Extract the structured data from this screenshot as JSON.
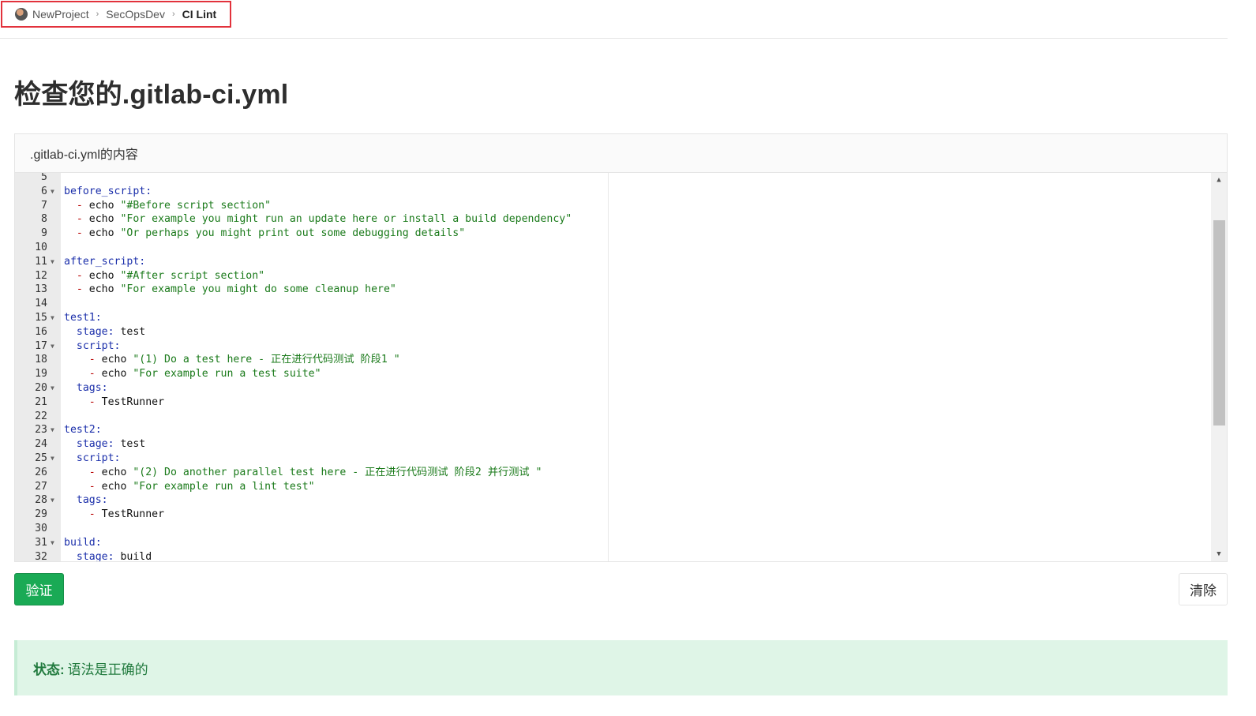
{
  "breadcrumb": {
    "items": [
      {
        "label": "NewProject"
      },
      {
        "label": "SecOpsDev"
      },
      {
        "label": "CI Lint"
      }
    ],
    "separator": "›"
  },
  "page": {
    "title": "检查您的.gitlab-ci.yml"
  },
  "panel": {
    "header": ".gitlab-ci.yml的内容"
  },
  "editor": {
    "lines": [
      {
        "n": "5",
        "fold": false,
        "tokens": []
      },
      {
        "n": "6",
        "fold": true,
        "tokens": [
          {
            "t": "key",
            "v": "before_script:"
          }
        ]
      },
      {
        "n": "7",
        "fold": false,
        "tokens": [
          {
            "t": "plain",
            "v": "  "
          },
          {
            "t": "dash",
            "v": "- "
          },
          {
            "t": "plain",
            "v": "echo "
          },
          {
            "t": "str",
            "v": "\"#Before script section\""
          }
        ]
      },
      {
        "n": "8",
        "fold": false,
        "tokens": [
          {
            "t": "plain",
            "v": "  "
          },
          {
            "t": "dash",
            "v": "- "
          },
          {
            "t": "plain",
            "v": "echo "
          },
          {
            "t": "str",
            "v": "\"For example you might run an update here or install a build dependency\""
          }
        ]
      },
      {
        "n": "9",
        "fold": false,
        "tokens": [
          {
            "t": "plain",
            "v": "  "
          },
          {
            "t": "dash",
            "v": "- "
          },
          {
            "t": "plain",
            "v": "echo "
          },
          {
            "t": "str",
            "v": "\"Or perhaps you might print out some debugging details\""
          }
        ]
      },
      {
        "n": "10",
        "fold": false,
        "tokens": []
      },
      {
        "n": "11",
        "fold": true,
        "tokens": [
          {
            "t": "key",
            "v": "after_script:"
          }
        ]
      },
      {
        "n": "12",
        "fold": false,
        "tokens": [
          {
            "t": "plain",
            "v": "  "
          },
          {
            "t": "dash",
            "v": "- "
          },
          {
            "t": "plain",
            "v": "echo "
          },
          {
            "t": "str",
            "v": "\"#After script section\""
          }
        ]
      },
      {
        "n": "13",
        "fold": false,
        "tokens": [
          {
            "t": "plain",
            "v": "  "
          },
          {
            "t": "dash",
            "v": "- "
          },
          {
            "t": "plain",
            "v": "echo "
          },
          {
            "t": "str",
            "v": "\"For example you might do some cleanup here\""
          }
        ]
      },
      {
        "n": "14",
        "fold": false,
        "tokens": []
      },
      {
        "n": "15",
        "fold": true,
        "tokens": [
          {
            "t": "key",
            "v": "test1:"
          }
        ]
      },
      {
        "n": "16",
        "fold": false,
        "tokens": [
          {
            "t": "plain",
            "v": "  "
          },
          {
            "t": "key",
            "v": "stage:"
          },
          {
            "t": "plain",
            "v": " test"
          }
        ]
      },
      {
        "n": "17",
        "fold": true,
        "tokens": [
          {
            "t": "plain",
            "v": "  "
          },
          {
            "t": "key",
            "v": "script:"
          }
        ]
      },
      {
        "n": "18",
        "fold": false,
        "tokens": [
          {
            "t": "plain",
            "v": "    "
          },
          {
            "t": "dash",
            "v": "- "
          },
          {
            "t": "plain",
            "v": "echo "
          },
          {
            "t": "str",
            "v": "\"(1) Do a test here - 正在进行代码测试 阶段1 \""
          }
        ]
      },
      {
        "n": "19",
        "fold": false,
        "tokens": [
          {
            "t": "plain",
            "v": "    "
          },
          {
            "t": "dash",
            "v": "- "
          },
          {
            "t": "plain",
            "v": "echo "
          },
          {
            "t": "str",
            "v": "\"For example run a test suite\""
          }
        ]
      },
      {
        "n": "20",
        "fold": true,
        "tokens": [
          {
            "t": "plain",
            "v": "  "
          },
          {
            "t": "key",
            "v": "tags:"
          }
        ]
      },
      {
        "n": "21",
        "fold": false,
        "tokens": [
          {
            "t": "plain",
            "v": "    "
          },
          {
            "t": "dash",
            "v": "- "
          },
          {
            "t": "plain",
            "v": "TestRunner"
          }
        ]
      },
      {
        "n": "22",
        "fold": false,
        "tokens": []
      },
      {
        "n": "23",
        "fold": true,
        "tokens": [
          {
            "t": "key",
            "v": "test2:"
          }
        ]
      },
      {
        "n": "24",
        "fold": false,
        "tokens": [
          {
            "t": "plain",
            "v": "  "
          },
          {
            "t": "key",
            "v": "stage:"
          },
          {
            "t": "plain",
            "v": " test"
          }
        ]
      },
      {
        "n": "25",
        "fold": true,
        "tokens": [
          {
            "t": "plain",
            "v": "  "
          },
          {
            "t": "key",
            "v": "script:"
          }
        ]
      },
      {
        "n": "26",
        "fold": false,
        "tokens": [
          {
            "t": "plain",
            "v": "    "
          },
          {
            "t": "dash",
            "v": "- "
          },
          {
            "t": "plain",
            "v": "echo "
          },
          {
            "t": "str",
            "v": "\"(2) Do another parallel test here - 正在进行代码测试 阶段2 并行测试 \""
          }
        ]
      },
      {
        "n": "27",
        "fold": false,
        "tokens": [
          {
            "t": "plain",
            "v": "    "
          },
          {
            "t": "dash",
            "v": "- "
          },
          {
            "t": "plain",
            "v": "echo "
          },
          {
            "t": "str",
            "v": "\"For example run a lint test\""
          }
        ]
      },
      {
        "n": "28",
        "fold": true,
        "tokens": [
          {
            "t": "plain",
            "v": "  "
          },
          {
            "t": "key",
            "v": "tags:"
          }
        ]
      },
      {
        "n": "29",
        "fold": false,
        "tokens": [
          {
            "t": "plain",
            "v": "    "
          },
          {
            "t": "dash",
            "v": "- "
          },
          {
            "t": "plain",
            "v": "TestRunner"
          }
        ]
      },
      {
        "n": "30",
        "fold": false,
        "tokens": []
      },
      {
        "n": "31",
        "fold": true,
        "tokens": [
          {
            "t": "key",
            "v": "build:"
          }
        ]
      },
      {
        "n": "32",
        "fold": false,
        "tokens": [
          {
            "t": "plain",
            "v": "  "
          },
          {
            "t": "key",
            "v": "stage:"
          },
          {
            "t": "plain",
            "v": " build"
          }
        ]
      }
    ]
  },
  "actions": {
    "validate_label": "验证",
    "clear_label": "清除"
  },
  "status": {
    "label": "状态:",
    "message": "语法是正确的"
  },
  "colors": {
    "validate_button": "#1aaa55",
    "status_background": "#dff5e7",
    "status_text": "#217a3e",
    "highlight_border": "#e2323c"
  },
  "icons": {
    "fold": "fold-arrow-icon",
    "scroll_up": "scroll-up-icon",
    "scroll_down": "scroll-down-icon",
    "project_avatar": "avatar"
  }
}
